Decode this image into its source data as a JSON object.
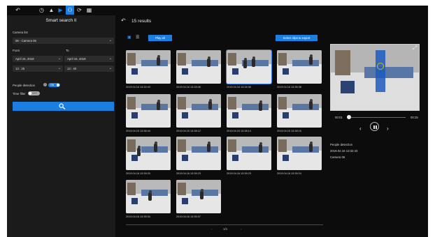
{
  "topbar": {
    "icons": [
      "back-arrow-icon",
      "clock-icon",
      "bell-icon",
      "video-icon",
      "smart-search-icon",
      "refresh-icon",
      "grid-icon"
    ],
    "glyphs": [
      "↶",
      "◷",
      "▲",
      "▶",
      "⚇",
      "⟳",
      "▦"
    ]
  },
  "left_panel": {
    "title": "Smart search II",
    "camera_list_label": "Camera list",
    "camera_selected": "06 - Camera 06",
    "from_label": "From",
    "to_label": "To",
    "from_date": "April 16, 2019",
    "to_date": "April 16, 2019",
    "from_time": "13 : 25",
    "to_time": "13 : 40",
    "people_detection_label": "People detection",
    "people_detection_toggle": "ON",
    "time_filter_label": "Time filter",
    "time_filter_toggle": "OFF",
    "chevron": "⌄"
  },
  "results": {
    "count_text": "15 results",
    "play_all_label": "Play all",
    "export_label": "Select clips to export",
    "items": [
      {
        "caption": "2019.04.16 13:32:43"
      },
      {
        "caption": "2019.04.16 13:33:46"
      },
      {
        "caption": "2019.04.16 13:34:36"
      },
      {
        "caption": "2019.04.16 13:35:38"
      },
      {
        "caption": "2019.04.16 13:36:44"
      },
      {
        "caption": "2019.04.16 13:38:12"
      },
      {
        "caption": "2019.04.16 13:38:14"
      },
      {
        "caption": "2019.04.16 13:38:15"
      },
      {
        "caption": "2019.04.16 13:39:20"
      },
      {
        "caption": "2019.04.16 13:39:23"
      },
      {
        "caption": "2019.04.16 13:39:23"
      },
      {
        "caption": "2019.04.16 13:39:24"
      },
      {
        "caption": "2019.04.16 13:39:34"
      },
      {
        "caption": "2019.04.16 13:39:37"
      }
    ],
    "selected_index": 2,
    "pager_text": "1/1",
    "pager_prev": "‹",
    "pager_next": "›"
  },
  "preview": {
    "start_time": "00:01",
    "end_time": "00:25",
    "progress": 0.04,
    "prev_glyph": "‹",
    "next_glyph": "›",
    "event_type": "People detection",
    "event_time": "2019.04.16 13:32:43",
    "camera_name": "Camera 06"
  },
  "colors": {
    "accent": "#1a7fe0",
    "panel_bg": "#1b1b1b",
    "app_bg": "#0c0c0c"
  }
}
